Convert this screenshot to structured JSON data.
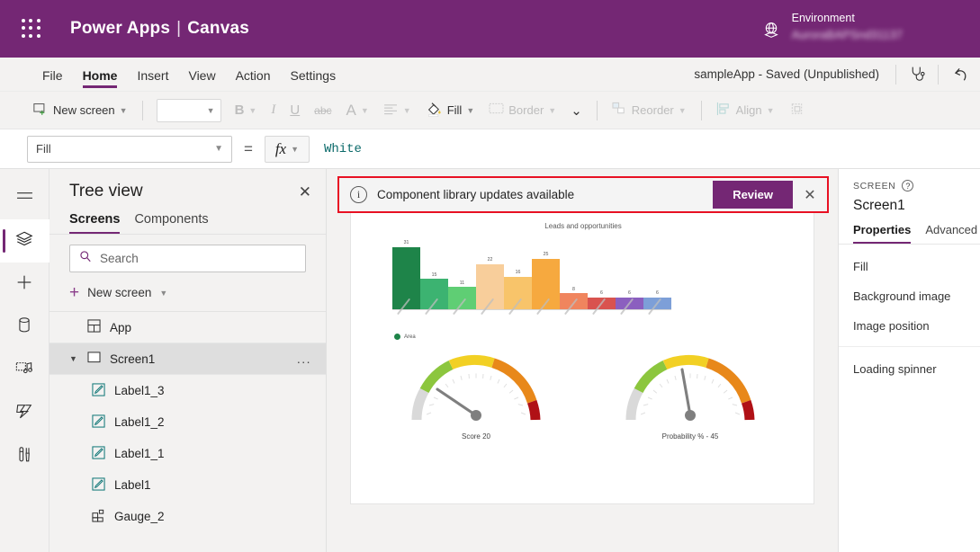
{
  "topbar": {
    "brand": "Power Apps",
    "separator": "|",
    "product": "Canvas",
    "waffle_icon": "waffle-icon",
    "globe_icon": "globe-environment-icon",
    "environment_label": "Environment",
    "environment_name": "AuroraBAPSnd31137"
  },
  "menubar": {
    "items": [
      {
        "label": "File",
        "active": false
      },
      {
        "label": "Home",
        "active": true
      },
      {
        "label": "Insert",
        "active": false
      },
      {
        "label": "View",
        "active": false
      },
      {
        "label": "Action",
        "active": false
      },
      {
        "label": "Settings",
        "active": false
      }
    ],
    "app_status": "sampleApp - Saved (Unpublished)",
    "checker_icon": "app-checker-stethoscope-icon",
    "undo_icon": "undo-icon"
  },
  "ribbon": {
    "new_screen": "New screen",
    "font_value": "",
    "bold": "B",
    "italic": "I",
    "underline": "U",
    "strikethrough": "abc",
    "font_color": "A",
    "fill": "Fill",
    "border": "Border",
    "reorder": "Reorder",
    "align": "Align",
    "more_icon": "chevron-down-icon",
    "group_icon": "group-icon"
  },
  "formula_bar": {
    "property": "Fill",
    "equals": "=",
    "fx": "fx",
    "value": "White"
  },
  "rail": {
    "items": [
      {
        "name": "menu-hamburger",
        "glyph": "hamburger-icon",
        "active": false
      },
      {
        "name": "tree-view",
        "glyph": "layers-icon",
        "active": true
      },
      {
        "name": "insert",
        "glyph": "plus-icon",
        "active": false
      },
      {
        "name": "data",
        "glyph": "database-icon",
        "active": false
      },
      {
        "name": "media",
        "glyph": "media-icon",
        "active": false
      },
      {
        "name": "power-automate",
        "glyph": "power-automate-icon",
        "active": false
      },
      {
        "name": "variables",
        "glyph": "tools-icon",
        "active": false
      }
    ]
  },
  "treeview": {
    "title": "Tree view",
    "close_icon": "close-icon",
    "tabs": [
      {
        "label": "Screens",
        "active": true
      },
      {
        "label": "Components",
        "active": false
      }
    ],
    "search_placeholder": "Search",
    "search_value": "",
    "search_icon": "search-icon",
    "new_screen": "New screen",
    "items": [
      {
        "label": "App",
        "icon": "app-icon",
        "indent": 0,
        "selected": false
      },
      {
        "label": "Screen1",
        "icon": "screen-icon",
        "indent": 0,
        "selected": true,
        "expanded": true,
        "overflow": "..."
      },
      {
        "label": "Label1_3",
        "icon": "label-icon",
        "indent": 1,
        "selected": false
      },
      {
        "label": "Label1_2",
        "icon": "label-icon",
        "indent": 1,
        "selected": false
      },
      {
        "label": "Label1_1",
        "icon": "label-icon",
        "indent": 1,
        "selected": false
      },
      {
        "label": "Label1",
        "icon": "label-icon",
        "indent": 1,
        "selected": false
      },
      {
        "label": "Gauge_2",
        "icon": "component-icon",
        "indent": 1,
        "selected": false
      }
    ]
  },
  "banner": {
    "info_icon": "info-icon",
    "message": "Component library updates available",
    "action_label": "Review",
    "close_icon": "close-icon",
    "highlight_color": "#e81123",
    "action_color": "#742774"
  },
  "properties_pane": {
    "kicker": "SCREEN",
    "help_icon": "help-icon",
    "selected_control": "Screen1",
    "tabs": [
      {
        "label": "Properties",
        "active": true
      },
      {
        "label": "Advanced",
        "active": false
      }
    ],
    "group1": [
      "Fill",
      "Background image",
      "Image position"
    ],
    "group2": [
      "Loading spinner"
    ]
  },
  "chart_data": [
    {
      "type": "bar",
      "title": "Leads and opportunities",
      "categories": [
        "",
        "",
        "",
        "",
        "",
        "",
        "",
        "",
        "",
        ""
      ],
      "values": [
        31,
        15,
        11,
        22,
        16,
        25,
        8,
        6,
        6,
        6
      ],
      "colors": [
        "#1e8449",
        "#3cb371",
        "#5fce74",
        "#f8ce9b",
        "#f8c46a",
        "#f6a93f",
        "#f0855e",
        "#d9534f",
        "#8b5fbf",
        "#7d9fd8"
      ],
      "legend": [
        "Area"
      ],
      "legend_position": "bottom-left",
      "legend_color": "#1e8449",
      "xlabel": "",
      "ylabel": "",
      "ylim": [
        0,
        34
      ],
      "grid": false,
      "x_tick_labels_rotated": true
    },
    {
      "type": "gauge",
      "label": "Score",
      "value": 20,
      "display": "Score   20",
      "min": 0,
      "max": 100,
      "bands": [
        {
          "color": "#d9d9d9",
          "from": 0,
          "to": 12
        },
        {
          "color": "#8cc63e",
          "from": 12,
          "to": 32
        },
        {
          "color": "#f2d024",
          "from": 32,
          "to": 55
        },
        {
          "color": "#e8881a",
          "from": 55,
          "to": 82
        },
        {
          "color": "#b01116",
          "from": 82,
          "to": 100
        }
      ],
      "needle_color": "#7f7f7f"
    },
    {
      "type": "gauge",
      "label": "Probability %",
      "value": 45,
      "display": "Probability % -  45",
      "min": 0,
      "max": 100,
      "bands": [
        {
          "color": "#d9d9d9",
          "from": 0,
          "to": 12
        },
        {
          "color": "#8cc63e",
          "from": 12,
          "to": 32
        },
        {
          "color": "#f2d024",
          "from": 32,
          "to": 55
        },
        {
          "color": "#e8881a",
          "from": 55,
          "to": 82
        },
        {
          "color": "#b01116",
          "from": 82,
          "to": 100
        }
      ],
      "needle_color": "#7f7f7f"
    }
  ]
}
